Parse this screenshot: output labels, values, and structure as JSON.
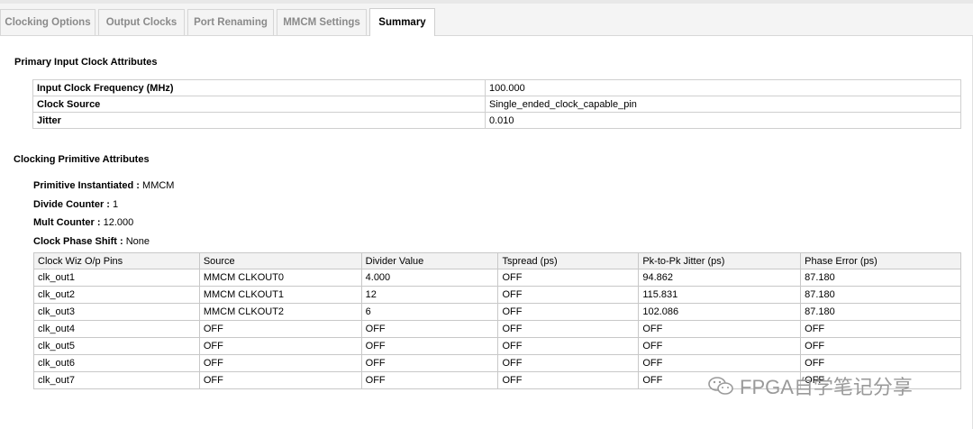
{
  "tabs": [
    {
      "label": "Clocking Options",
      "active": false
    },
    {
      "label": "Output Clocks",
      "active": false
    },
    {
      "label": "Port Renaming",
      "active": false
    },
    {
      "label": "MMCM Settings",
      "active": false
    },
    {
      "label": "Summary",
      "active": true
    }
  ],
  "primary_input": {
    "title": "Primary Input Clock Attributes",
    "rows": [
      {
        "key": "Input Clock Frequency (MHz)",
        "value": "100.000"
      },
      {
        "key": "Clock Source",
        "value": "Single_ended_clock_capable_pin"
      },
      {
        "key": "Jitter",
        "value": "0.010"
      }
    ]
  },
  "primitive": {
    "title": "Clocking Primitive Attributes",
    "items": [
      {
        "key": "Primitive Instantiated :",
        "value": " MMCM"
      },
      {
        "key": "Divide Counter :",
        "value": " 1"
      },
      {
        "key": "Mult Counter :",
        "value": " 12.000"
      },
      {
        "key": "Clock Phase Shift :",
        "value": " None"
      }
    ]
  },
  "clock_table": {
    "headers": [
      "Clock Wiz O/p Pins",
      "Source",
      "Divider Value",
      "Tspread (ps)",
      "Pk-to-Pk Jitter (ps)",
      "Phase Error (ps)"
    ],
    "rows": [
      [
        "clk_out1",
        "MMCM CLKOUT0",
        "4.000",
        "OFF",
        "94.862",
        "87.180"
      ],
      [
        "clk_out2",
        "MMCM CLKOUT1",
        "12",
        "OFF",
        "115.831",
        "87.180"
      ],
      [
        "clk_out3",
        "MMCM CLKOUT2",
        "6",
        "OFF",
        "102.086",
        "87.180"
      ],
      [
        "clk_out4",
        "OFF",
        "OFF",
        "OFF",
        "OFF",
        "OFF"
      ],
      [
        "clk_out5",
        "OFF",
        "OFF",
        "OFF",
        "OFF",
        "OFF"
      ],
      [
        "clk_out6",
        "OFF",
        "OFF",
        "OFF",
        "OFF",
        "OFF"
      ],
      [
        "clk_out7",
        "OFF",
        "OFF",
        "OFF",
        "OFF",
        "OFF"
      ]
    ]
  },
  "watermark": {
    "text": "FPGA自学笔记分享",
    "icon": "wechat-icon"
  }
}
